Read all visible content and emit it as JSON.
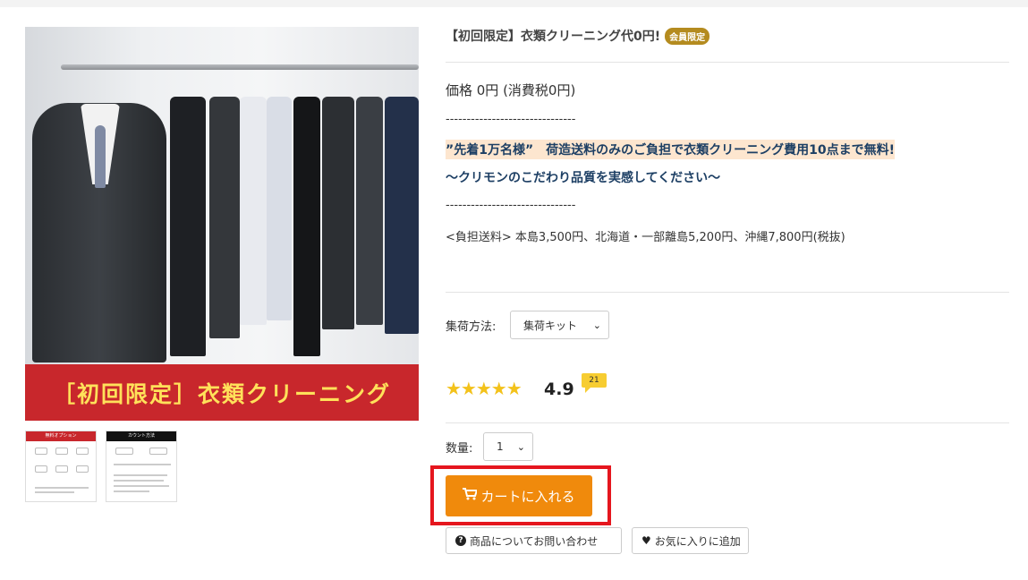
{
  "product": {
    "title": "【初回限定】衣類クリーニング代0円!",
    "member_badge": "会員限定",
    "price_text": "価格 0円 (消費税0円)",
    "divider_text": "-------------------------------",
    "promo_line1": "”先着1万名様”　荷造送料のみのご負担で衣類クリーニング費用10点まで無料!",
    "promo_line2": "〜クリモンのこだわり品質を実感してください〜",
    "shipping_text": "<負担送料> 本島3,500円、北海道・一部離島5,200円、沖縄7,800円(税抜)"
  },
  "gallery": {
    "banner_text": "［初回限定］衣類クリーニング",
    "thumb1_header": "無料オプション",
    "thumb2_header": "カウント方法"
  },
  "collection": {
    "label": "集荷方法:",
    "selected": "集荷キット"
  },
  "rating": {
    "stars": "★★★★★",
    "score": "4.9",
    "review_count": "21",
    "value": 4.9,
    "max": 5
  },
  "quantity": {
    "label": "数量:",
    "selected": "1"
  },
  "actions": {
    "cart_label": "カートに入れる",
    "inquiry_label": "商品についてお問い合わせ",
    "favorite_label": "お気に入りに追加"
  },
  "icons": {
    "cart": "cart-icon",
    "question": "question-circle-icon",
    "heart": "heart-icon",
    "chevron": "chevron-down-icon"
  },
  "colors": {
    "cart_button": "#f08a0c",
    "highlight_border": "#e5161e",
    "badge": "#b48b1f",
    "banner": "#c8272c",
    "banner_text": "#ffe15a",
    "stars": "#f3c21b",
    "promo_text": "#1d3f64",
    "promo_bg": "#fde6cf"
  }
}
